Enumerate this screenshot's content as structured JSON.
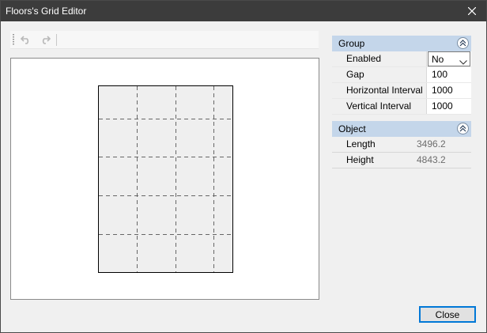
{
  "window": {
    "title": "Floors's Grid Editor"
  },
  "toolbar": {
    "undo_icon": "undo-icon",
    "redo_icon": "redo-icon"
  },
  "properties": {
    "group": {
      "header": "Group",
      "rows": [
        {
          "name": "Enabled",
          "value": "No"
        },
        {
          "name": "Gap",
          "value": "100"
        },
        {
          "name": "Horizontal Interval",
          "value": "1000"
        },
        {
          "name": "Vertical Interval",
          "value": "1000"
        }
      ]
    },
    "object": {
      "header": "Object",
      "rows": [
        {
          "name": "Length",
          "value": "3496.2"
        },
        {
          "name": "Height",
          "value": "4843.2"
        }
      ]
    }
  },
  "footer": {
    "close_label": "Close"
  },
  "colors": {
    "titlebar": "#3c3c3c",
    "group_header": "#c4d6ea",
    "accent": "#0078d7"
  }
}
